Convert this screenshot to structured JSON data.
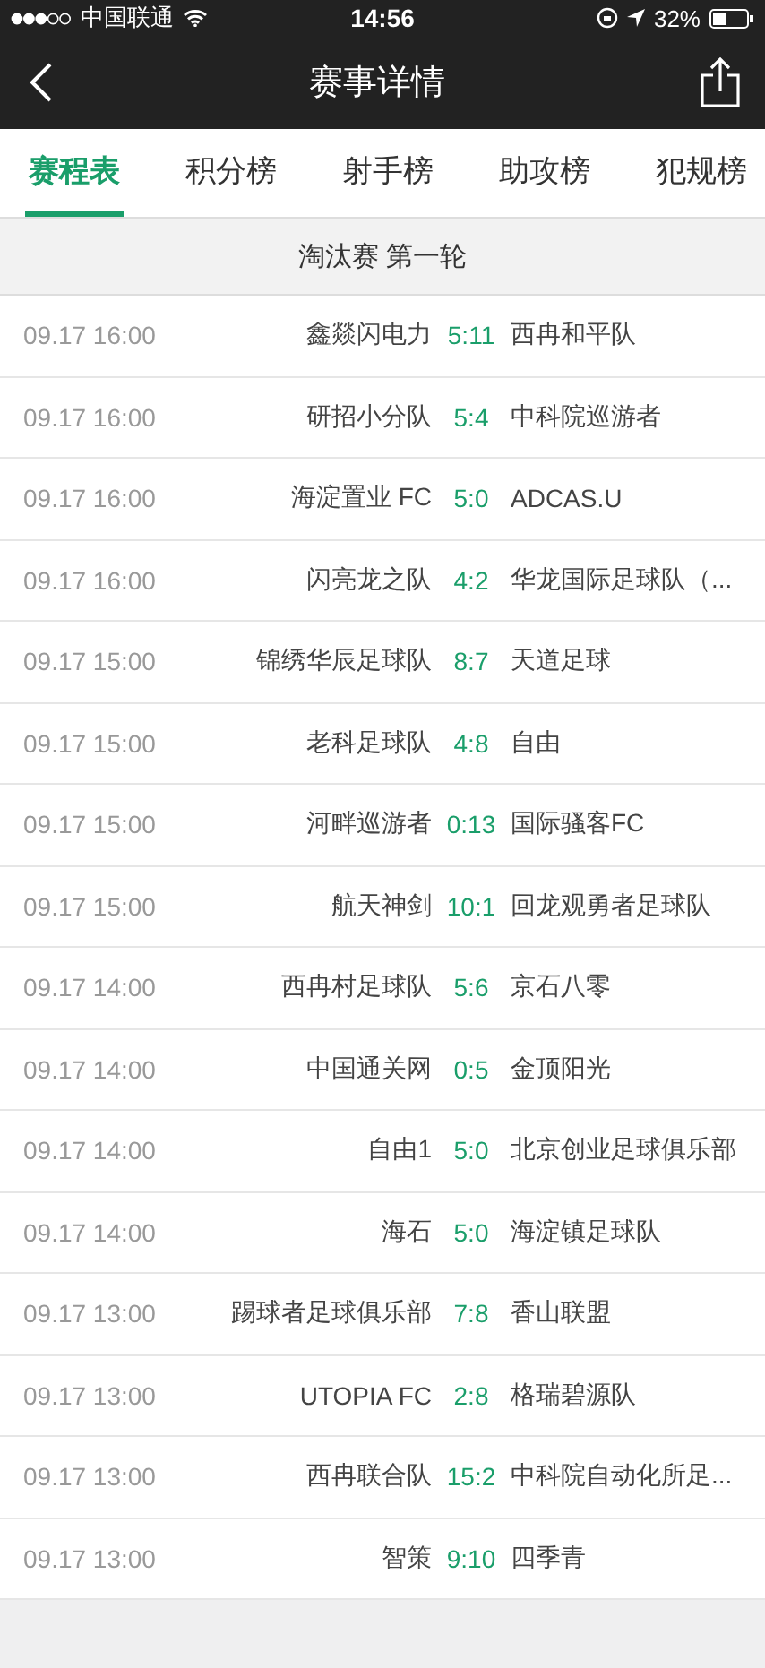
{
  "status_bar": {
    "carrier": "中国联通",
    "time": "14:56",
    "battery": "32%"
  },
  "nav_bar": {
    "title": "赛事详情"
  },
  "tabs": [
    {
      "label": "赛程表",
      "selected": true
    },
    {
      "label": "积分榜",
      "selected": false
    },
    {
      "label": "射手榜",
      "selected": false
    },
    {
      "label": "助攻榜",
      "selected": false
    },
    {
      "label": "犯规榜",
      "selected": false
    }
  ],
  "section": {
    "title": "淘汰赛 第一轮"
  },
  "matches": [
    {
      "time": "09.17 16:00",
      "home": "鑫燚闪电力",
      "score": "5:11",
      "away": "西冉和平队"
    },
    {
      "time": "09.17 16:00",
      "home": "研招小分队",
      "score": "5:4",
      "away": "中科院巡游者"
    },
    {
      "time": "09.17 16:00",
      "home": "海淀置业 FC",
      "score": "5:0",
      "away": "ADCAS.U"
    },
    {
      "time": "09.17 16:00",
      "home": "闪亮龙之队",
      "score": "4:2",
      "away": "华龙国际足球队（..."
    },
    {
      "time": "09.17 15:00",
      "home": "锦绣华辰足球队",
      "score": "8:7",
      "away": "天道足球"
    },
    {
      "time": "09.17 15:00",
      "home": "老科足球队",
      "score": "4:8",
      "away": "自由"
    },
    {
      "time": "09.17 15:00",
      "home": "河畔巡游者",
      "score": "0:13",
      "away": "国际骚客FC"
    },
    {
      "time": "09.17 15:00",
      "home": "航天神剑",
      "score": "10:1",
      "away": "回龙观勇者足球队"
    },
    {
      "time": "09.17 14:00",
      "home": "西冉村足球队",
      "score": "5:6",
      "away": "京石八零"
    },
    {
      "time": "09.17 14:00",
      "home": "中国通关网",
      "score": "0:5",
      "away": "金顶阳光"
    },
    {
      "time": "09.17 14:00",
      "home": "自由1",
      "score": "5:0",
      "away": "北京创业足球俱乐部"
    },
    {
      "time": "09.17 14:00",
      "home": "海石",
      "score": "5:0",
      "away": "海淀镇足球队"
    },
    {
      "time": "09.17 13:00",
      "home": "踢球者足球俱乐部",
      "score": "7:8",
      "away": "香山联盟"
    },
    {
      "time": "09.17 13:00",
      "home": "UTOPIA FC",
      "score": "2:8",
      "away": "格瑞碧源队"
    },
    {
      "time": "09.17 13:00",
      "home": "西冉联合队",
      "score": "15:2",
      "away": "中科院自动化所足..."
    },
    {
      "time": "09.17 13:00",
      "home": "智策",
      "score": "9:10",
      "away": "四季青"
    }
  ]
}
